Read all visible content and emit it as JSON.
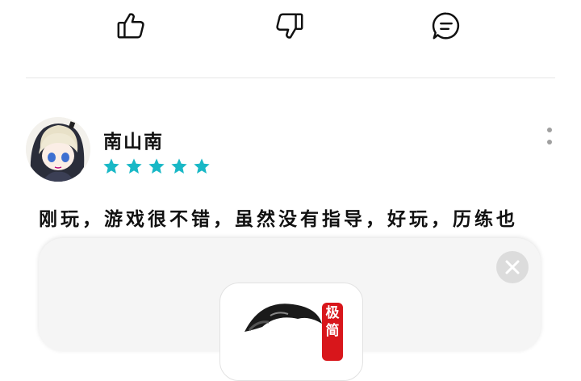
{
  "actions": [
    {
      "icon": "thumbs-up-icon"
    },
    {
      "icon": "thumbs-down-icon"
    },
    {
      "icon": "comment-icon"
    }
  ],
  "review": {
    "username": "南山南",
    "rating": 5,
    "rating_max": 5,
    "star_color": "#19b8c6",
    "text": "刚玩，游戏很不错，虽然没有指导，好玩，历练也"
  },
  "popup": {
    "close_icon": "close-icon",
    "app_badge": "极简"
  }
}
